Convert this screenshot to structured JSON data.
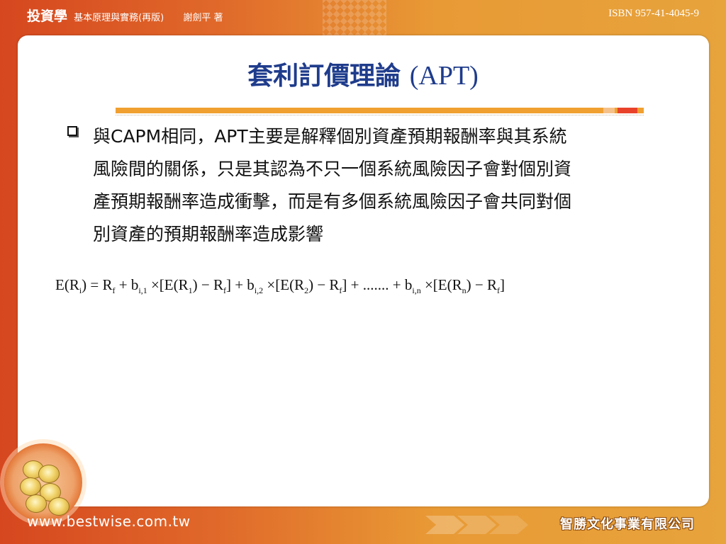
{
  "header": {
    "book_title": "投資學",
    "subtitle": "基本原理與實務(再版)",
    "author": "謝劍平 著",
    "isbn": "ISBN 957-41-4045-9"
  },
  "slide": {
    "title_cn": "套利訂價理論",
    "title_en": "(APT)",
    "bullet_lines": [
      "與CAPM相同，APT主要是解釋個別資產預期報酬率與其系統",
      "風險間的關係，只是其認為不只一個系統風險因子會對個別資",
      "產預期報酬率造成衝擊，而是有多個系統風險因子會共同對個",
      "別資產的預期報酬率造成影響"
    ],
    "formula": {
      "E": "E(R",
      "i": "i",
      "eq": ") = R",
      "f": "f",
      "plus_b": " + b",
      "i1": "i,1",
      "times_E1": " ×[E(R",
      "one": "1",
      "minus_R1": ") − R",
      "f1": "f",
      "close_plus_b2": "] + b",
      "i2": "i,2",
      "times_E2": " ×[E(R",
      "two": "2",
      "minus_R2": ") − R",
      "f2": "f",
      "dots": "] + ....... + b",
      "in": "i,n",
      "times_En": " ×[E(R",
      "n": "n",
      "minus_Rn": ") − R",
      "fn": "f",
      "end": "]"
    }
  },
  "footer": {
    "website": "www.bestwise.com.tw",
    "publisher": "智勝文化事業有限公司"
  },
  "colors": {
    "title": "#1f3c8c",
    "accent_line": "#f0a030",
    "accent_red": "#e8432a"
  }
}
